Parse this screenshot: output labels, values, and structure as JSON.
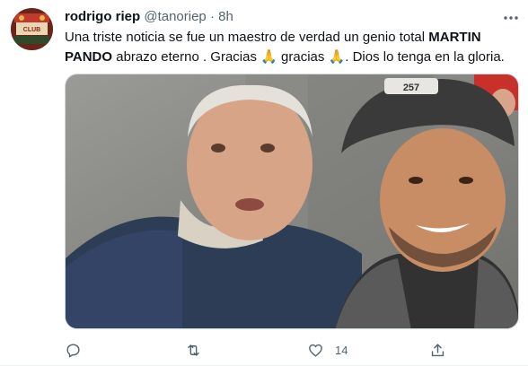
{
  "tweet": {
    "author_name": "rodrigo riep",
    "handle": "@tanoriep",
    "separator": "·",
    "time": "8h",
    "text_part1": "Una triste noticia se fue un maestro de verdad un genio total ",
    "text_bold": "MARTIN PANDO",
    "text_part2": "  abrazo eterno . Gracias ",
    "text_part3": " gracias ",
    "text_part4": ". Dios lo tenga en la gloria.",
    "emoji": "🙏",
    "photo_visible_text": "257",
    "likes_count": "14"
  },
  "icons": {
    "more": "more-horizontal-icon",
    "reply": "reply-icon",
    "retweet": "retweet-icon",
    "like": "heart-icon",
    "share": "share-icon"
  },
  "colors": {
    "text": "#0f1419",
    "secondary": "#536471",
    "border": "#cfd9de"
  }
}
